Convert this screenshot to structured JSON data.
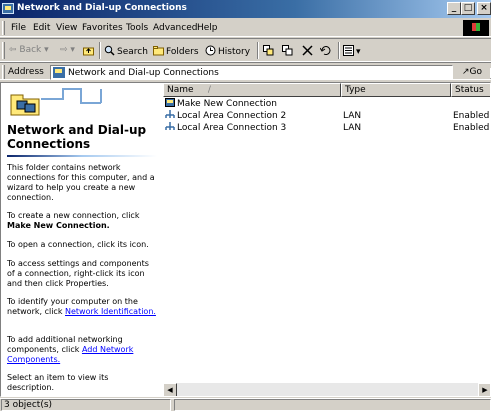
{
  "window": {
    "title": "Network and Dial-up Connections",
    "min": "_",
    "max": "□",
    "close": "×"
  },
  "menu": [
    {
      "label": "File"
    },
    {
      "label": "Edit"
    },
    {
      "label": "View"
    },
    {
      "label": "Favorites"
    },
    {
      "label": "Tools"
    },
    {
      "label": "Advanced"
    },
    {
      "label": "Help"
    }
  ],
  "toolbar": {
    "back": "Back",
    "search": "Search",
    "folders": "Folders",
    "history": "History"
  },
  "address": {
    "label": "Address",
    "value": "Network and Dial-up Connections",
    "go": "Go"
  },
  "left": {
    "title": "Network and Dial-up Connections",
    "p1": "This folder contains network connections for this computer, and a wizard to help you create a new connection.",
    "p2_text": "To create a new connection, click",
    "p2_bold": "Make New Connection.",
    "p3": "To open a connection, click its icon.",
    "p4": "To access settings and components of a connection, right-click its icon and then click Properties.",
    "p5_text": "To identify your computer on the network, click",
    "p5_link": "Network Identification.",
    "p6_text": "To add additional networking components, click",
    "p6_link": "Add Network Components.",
    "p7": "Select an item to view its description."
  },
  "list": {
    "columns": [
      "Name",
      "Type",
      "Status"
    ],
    "sort_indicator": "/",
    "rows": [
      {
        "name": "Make New Connection",
        "type": "",
        "status": ""
      },
      {
        "name": "Local Area Connection 2",
        "type": "LAN",
        "status": "Enabled"
      },
      {
        "name": "Local Area Connection 3",
        "type": "LAN",
        "status": "Enabled"
      }
    ]
  },
  "status": {
    "text": "3 object(s)"
  },
  "colors": {
    "title_start": "#0a246a",
    "title_end": "#a6caf0",
    "face": "#d4d0c8",
    "link": "#0000ff"
  }
}
